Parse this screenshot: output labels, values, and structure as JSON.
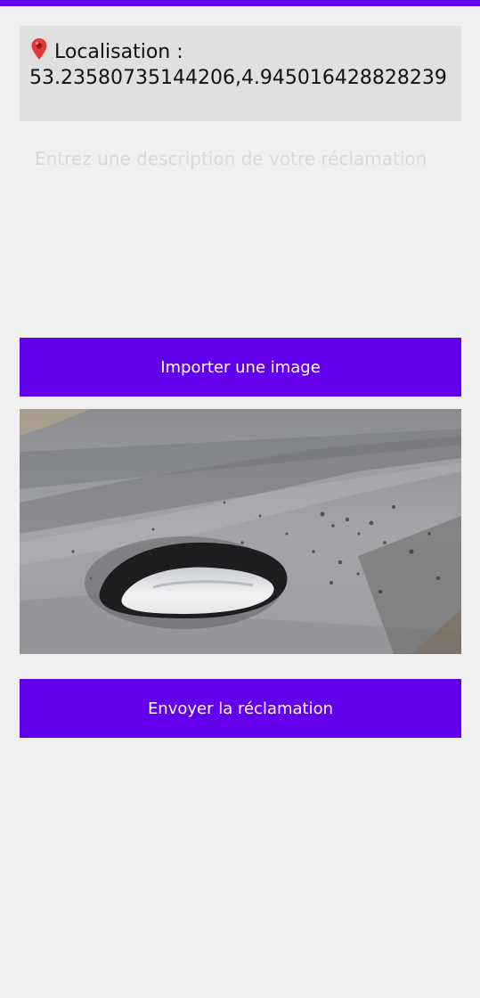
{
  "colors": {
    "accent": "#6200ee",
    "card_background": "#e0e0e0",
    "page_background": "#f0f0f0"
  },
  "location": {
    "icon": "pin-icon",
    "label": "Localisation :",
    "coordinates": "53.23580735144206,4.945016428828239"
  },
  "description": {
    "placeholder": "Entrez une description de votre réclamation",
    "value": ""
  },
  "import_button": {
    "label": "Importer une image"
  },
  "photo": {
    "subject": "pothole in asphalt road"
  },
  "send_button": {
    "label": "Envoyer la réclamation"
  }
}
